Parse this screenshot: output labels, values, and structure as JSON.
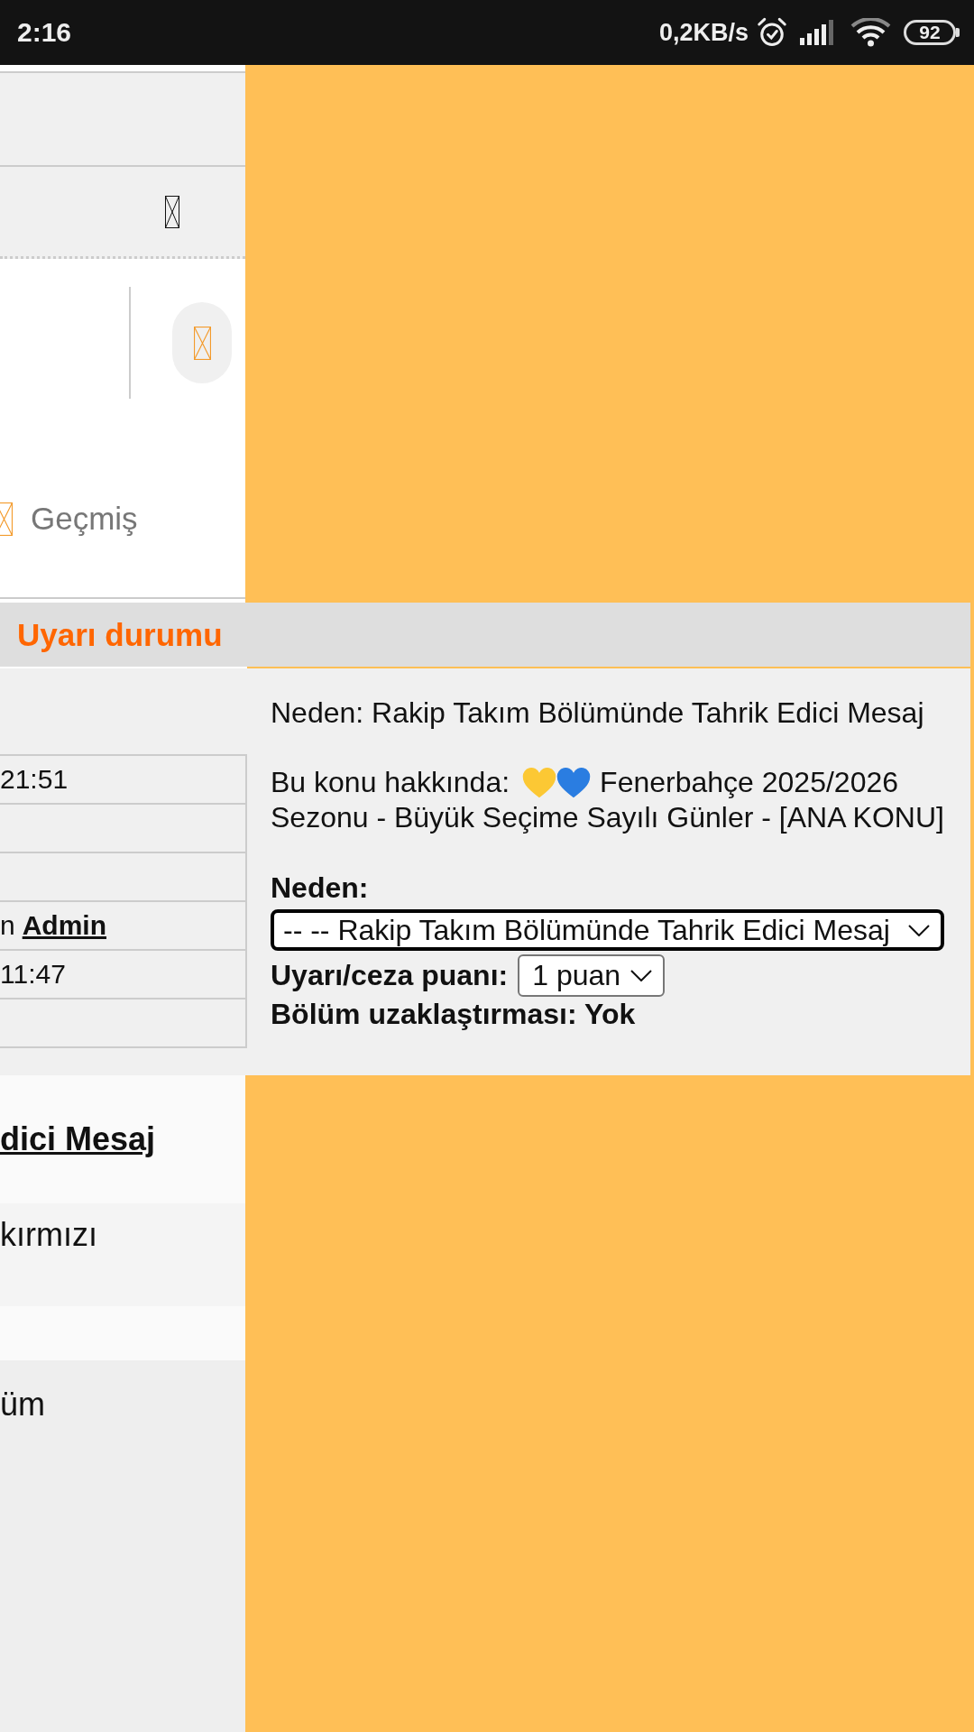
{
  "status_bar": {
    "time": "2:16",
    "net_speed": "0,2KB/s",
    "battery": "92"
  },
  "side_panel": {
    "history_tab": {
      "label": "Geçmiş"
    }
  },
  "warning_panel": {
    "title": "Uyarı durumu",
    "log_cells": [
      {
        "kind": "text",
        "text": "21:51"
      },
      {
        "kind": "empty"
      },
      {
        "kind": "empty"
      },
      {
        "kind": "link",
        "prefix": "n",
        "link": "Admin"
      },
      {
        "kind": "text",
        "text": "11:47"
      },
      {
        "kind": "empty"
      }
    ],
    "reason_line": "Neden: Rakip Takım Bölümünde Tahrik Edici Mesaj",
    "topic": {
      "label": "Bu konu hakkında:",
      "hearts": [
        {
          "color": "#fcc834"
        },
        {
          "color": "#2a7de1"
        }
      ],
      "title_lines": [
        "Fenerbahçe 2025/2026",
        "Sezonu - Büyük Seçime Sayılı Günler - [ANA KONU]"
      ]
    },
    "reason_field": {
      "label": "Neden:",
      "value": "-- -- Rakip Takım Bölümünde Tahrik Edici Mesaj"
    },
    "points_field": {
      "label": "Uyarı/ceza puanı:",
      "value": "1 puan"
    },
    "ban_line": "Bölüm uzaklaştırması: Yok"
  },
  "post_rows": [
    {
      "kind": "link",
      "text": "dici Mesaj"
    },
    {
      "kind": "text",
      "text": "kırmızı"
    },
    {
      "kind": "empty"
    },
    {
      "kind": "text",
      "text": "üm"
    }
  ]
}
